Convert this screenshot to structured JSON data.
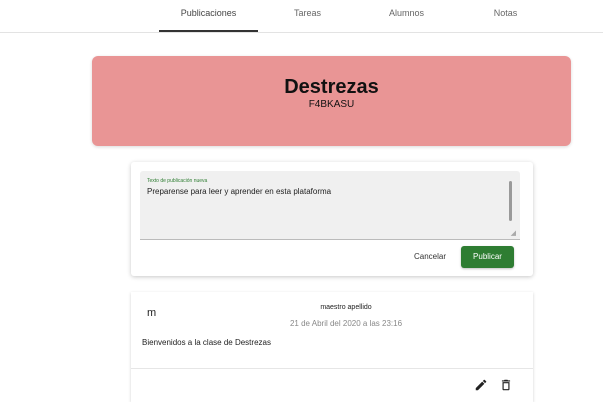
{
  "tabs": [
    {
      "label": "Publicaciones",
      "active": true
    },
    {
      "label": "Tareas",
      "active": false
    },
    {
      "label": "Alumnos",
      "active": false
    },
    {
      "label": "Notas",
      "active": false
    }
  ],
  "banner": {
    "title": "Destrezas",
    "code": "F4BKASU",
    "color": "#e99595"
  },
  "composer": {
    "label": "Texto de publicación nueva",
    "value": "Preparense para leer y aprender en esta plataforma",
    "cancel_label": "Cancelar",
    "publish_label": "Publicar",
    "accent_color": "#2e7d32"
  },
  "post": {
    "avatar_initial": "m",
    "author": "maestro apellido",
    "date": "21 de Abril del 2020 a las 23:16",
    "body": "Bienvenidos a la clase de Destrezas",
    "actions": [
      "pencil-icon",
      "trash-icon"
    ]
  }
}
